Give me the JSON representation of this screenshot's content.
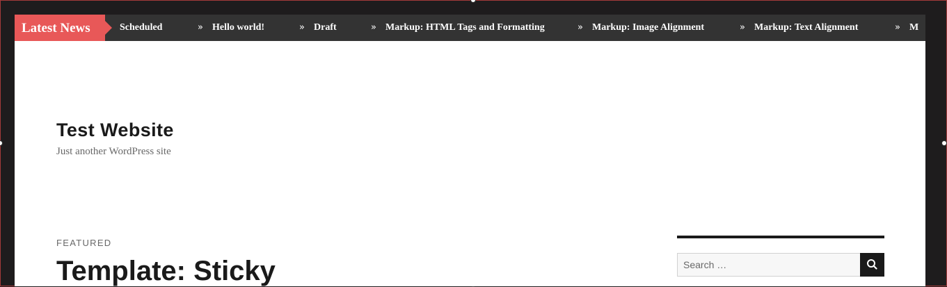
{
  "ticker": {
    "label": "Latest News",
    "separator": "»",
    "items": [
      "Scheduled",
      "Hello world!",
      "Draft",
      "Markup: HTML Tags and Formatting",
      "Markup: Image Alignment",
      "Markup: Text Alignment",
      "M"
    ]
  },
  "header": {
    "site_title": "Test Website",
    "site_description": "Just another WordPress site"
  },
  "post": {
    "kicker": "FEATURED",
    "title": "Template: Sticky"
  },
  "sidebar": {
    "search": {
      "placeholder": "Search …",
      "button_icon": "search-icon"
    }
  },
  "colors": {
    "ticker_label_bg": "#e85858",
    "ticker_bg": "#333333",
    "frame_border": "#a43a3a"
  }
}
